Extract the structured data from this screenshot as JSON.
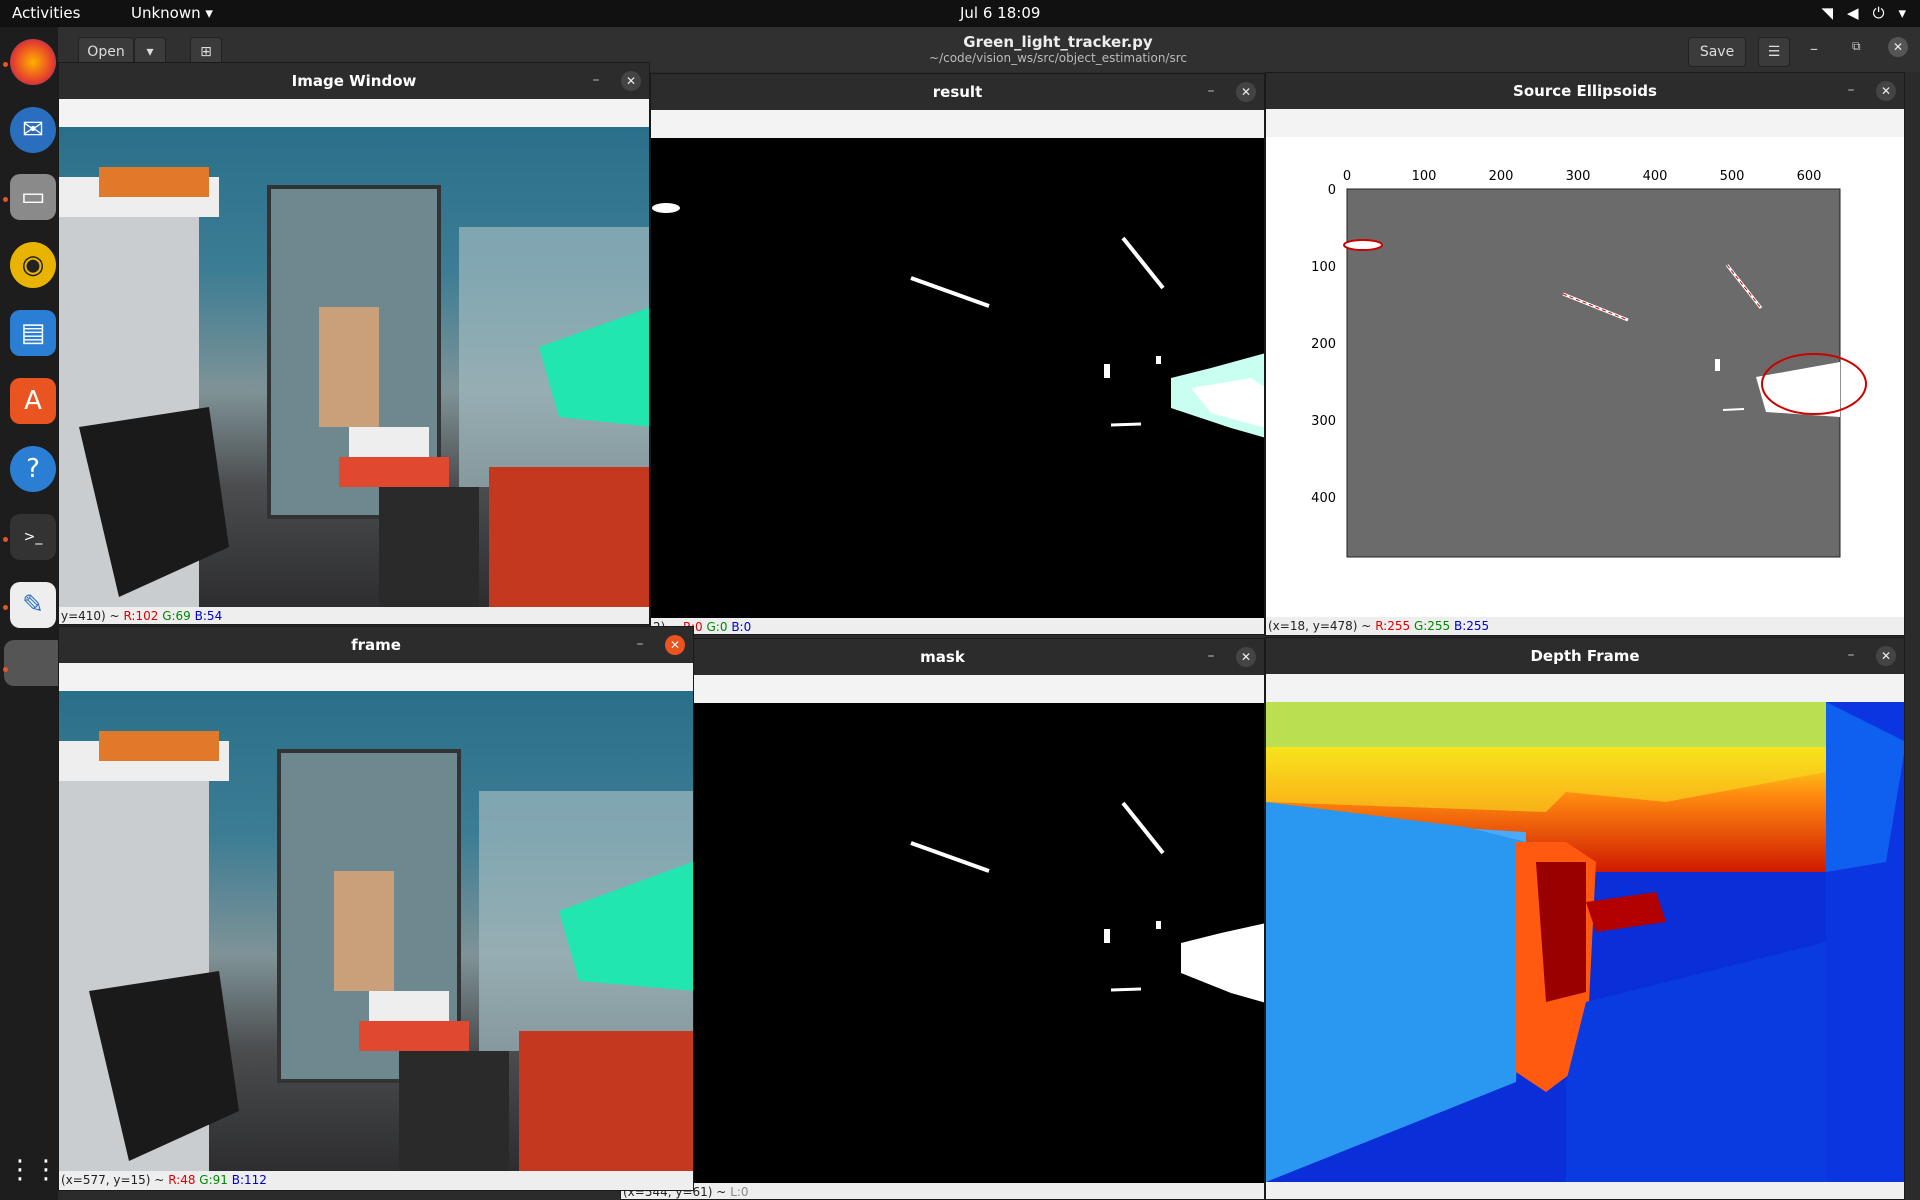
{
  "topbar": {
    "activities": "Activities",
    "app_menu": "Unknown",
    "clock": "Jul 6  18:09",
    "status_icons": [
      "wifi-icon",
      "volume-icon",
      "power-icon",
      "chevron-down-icon"
    ]
  },
  "dock": {
    "apps": [
      "firefox-icon",
      "thunderbird-icon",
      "files-icon",
      "rhythmbox-icon",
      "libreoffice-writer-icon",
      "software-icon",
      "help-icon",
      "terminal-icon",
      "text-editor-icon",
      "show-apps-icon"
    ]
  },
  "gedit": {
    "open_label": "Open",
    "title": "Green_light_tracker.py",
    "path": "~/code/vision_ws/src/object_estimation/src",
    "save_label": "Save"
  },
  "windows": {
    "image_window": {
      "title": "Image Window",
      "status_xy": "y=410) ~",
      "r": "R:102",
      "g": "G:69",
      "b": "B:54"
    },
    "result": {
      "title": "result",
      "status_xy": "2) ~",
      "r": "R:0",
      "g": "G:0",
      "b": "B:0"
    },
    "source_ellipsoids": {
      "title": "Source Ellipsoids",
      "status_xy": "(x=18, y=478) ~",
      "r": "R:255",
      "g": "G:255",
      "b": "B:255"
    },
    "frame": {
      "title": "frame",
      "status_xy": "(x=577, y=15) ~",
      "r": "R:48",
      "g": "G:91",
      "b": "B:112"
    },
    "mask": {
      "title": "mask",
      "status_xy": "(x=544, y=61) ~",
      "l": "L:0"
    },
    "depth_frame": {
      "title": "Depth Frame"
    }
  },
  "plot": {
    "xticks": [
      "0",
      "100",
      "200",
      "300",
      "400",
      "500",
      "600"
    ],
    "yticks": [
      "0",
      "100",
      "200",
      "300",
      "400"
    ]
  }
}
